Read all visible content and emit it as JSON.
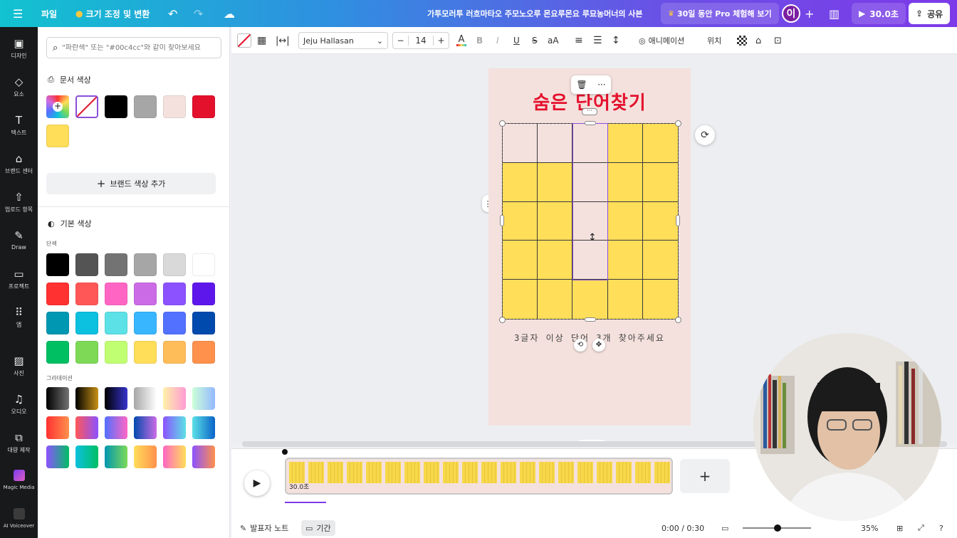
{
  "topbar": {
    "menu_icon": "hamburger-icon",
    "file": "파일",
    "resize": "크기 조정 및 변환",
    "design_title": "가투모러투 러흐마타오 주모노오루 몬요루몬요 루묘농머너의 사본",
    "pro_trial": "30일 동안 Pro 체험해 보기",
    "avatar_letter": "이",
    "play_duration": "30.0초",
    "share": "공유"
  },
  "rail": {
    "items": [
      {
        "label": "디자인",
        "icon": "layout-icon"
      },
      {
        "label": "요소",
        "icon": "shapes-icon"
      },
      {
        "label": "텍스트",
        "icon": "text-icon"
      },
      {
        "label": "브랜드 센터",
        "icon": "brand-icon"
      },
      {
        "label": "업로드 항목",
        "icon": "upload-icon"
      },
      {
        "label": "Draw",
        "icon": "pen-icon"
      },
      {
        "label": "프로젝트",
        "icon": "folder-icon"
      },
      {
        "label": "앱",
        "icon": "apps-icon"
      },
      {
        "label": "사진",
        "icon": "photo-icon"
      },
      {
        "label": "오디오",
        "icon": "music-icon"
      },
      {
        "label": "대량 제작",
        "icon": "bulk-icon"
      },
      {
        "label": "Magic Media",
        "icon": "magic-media-icon"
      },
      {
        "label": "AI Voiceover",
        "icon": "voiceover-icon"
      }
    ]
  },
  "color_panel": {
    "search_placeholder": "\"파란색\" 또는 \"#00c4cc\"와 같이 찾아보세요",
    "document_colors_title": "문서 색상",
    "document_colors": [
      "#ffffff",
      "#000000",
      "#a6a6a6",
      "#f4e1dd",
      "#e4112d",
      "#ffde59"
    ],
    "add_brand_color": "브랜드 색상 추가",
    "default_colors_title": "기본 색상",
    "solid_label": "단색",
    "solid_colors": [
      [
        "#000000",
        "#545454",
        "#737373",
        "#a6a6a6",
        "#d9d9d9",
        "#ffffff"
      ],
      [
        "#ff3131",
        "#ff5757",
        "#ff66c4",
        "#cb6ce6",
        "#8c52ff",
        "#5e17eb"
      ],
      [
        "#0097b2",
        "#0cc0df",
        "#5ce1e6",
        "#38b6ff",
        "#5271ff",
        "#004aad"
      ],
      [
        "#00bf63",
        "#7ed957",
        "#c1ff72",
        "#ffde59",
        "#ffbd59",
        "#ff914d"
      ]
    ],
    "gradient_label": "그라데이션",
    "gradients": [
      [
        "linear-gradient(90deg,#000,#737373)",
        "linear-gradient(90deg,#000,#c89116)",
        "linear-gradient(90deg,#000,#3533cd)",
        "linear-gradient(90deg,#a6a6a6,#fff)",
        "linear-gradient(90deg,#fff1a8,#ff9bd3)",
        "linear-gradient(90deg,#cdffd8,#94b9ff)"
      ],
      [
        "linear-gradient(90deg,#ff3131,#ff914d)",
        "linear-gradient(90deg,#ff5757,#8c52ff)",
        "linear-gradient(90deg,#5170ff,#ff66c4)",
        "linear-gradient(90deg,#004aad,#cb6ce6)",
        "linear-gradient(90deg,#8c52ff,#5ce1e6)",
        "linear-gradient(90deg,#5ce1e6,#0a63c9)"
      ],
      [
        "linear-gradient(90deg,#8c52ff,#00bf63)",
        "linear-gradient(90deg,#0cc0df,#00bf63)",
        "linear-gradient(90deg,#0097b2,#7ed957)",
        "linear-gradient(90deg,#ffde59,#ff914d)",
        "linear-gradient(90deg,#ff66c4,#ffde59)",
        "linear-gradient(90deg,#8c52ff,#ff914d)"
      ]
    ]
  },
  "toolbar": {
    "font": "Jeju Hallasan",
    "font_size": "14",
    "minus": "−",
    "plus": "+",
    "bold": "B",
    "italic": "I",
    "underline": "U",
    "strike": "S",
    "case": "aA",
    "animation": "애니메이션",
    "position": "위치"
  },
  "canvas": {
    "title": "숨은 단어찾기",
    "caption": "3글자 이상 단어 3개 찾아주세요",
    "grid_colors": [
      [
        "#f4e1dd",
        "#f4e1dd",
        "#f4e1dd",
        "#ffde59",
        "#ffde59"
      ],
      [
        "#ffde59",
        "#ffde59",
        "#f4e1dd",
        "#ffde59",
        "#ffde59"
      ],
      [
        "#ffde59",
        "#ffde59",
        "#f4e1dd",
        "#ffde59",
        "#ffde59"
      ],
      [
        "#ffde59",
        "#ffde59",
        "#f4e1dd",
        "#ffde59",
        "#ffde59"
      ],
      [
        "#ffde59",
        "#ffde59",
        "#ffde59",
        "#ffde59",
        "#ffde59"
      ]
    ]
  },
  "timeline": {
    "clip_duration": "30.0초",
    "notes": "발표자 노트",
    "duration": "기간",
    "time": "0:00 / 0:30",
    "zoom": "35%"
  }
}
